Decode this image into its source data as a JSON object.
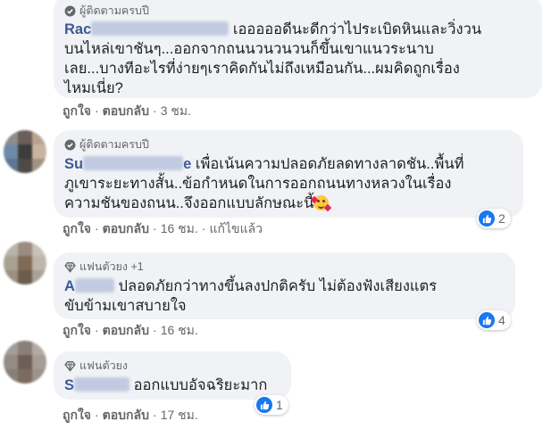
{
  "comments": [
    {
      "badge": "ผู้ติดตามครบปี",
      "badge_icon": "top-fan-badge-icon",
      "name_visible": "Rac",
      "name_tail": "",
      "text_after_name": "เอออออดีนะดีกว่าไประเบิดหินและวิ่งวน",
      "lines": [
        "บนไหล่เขาชันๆ...ออกจากถนนวนวนวนก็ขึ้นเขาแนวระนาบ",
        "เลย...บางทีอะไรที่ง่ายๆเราคิดกันไม่ถึงเหมือนกัน...ผมคิดถูกเรื่อง",
        "ไหมเนี่ย?"
      ],
      "like_label": "ถูกใจ",
      "reply_label": "ตอบกลับ",
      "time": "3 ชม.",
      "edited": "",
      "reaction_count": ""
    },
    {
      "badge": "ผู้ติดตามครบปี",
      "badge_icon": "top-fan-badge-icon",
      "name_visible": "Su",
      "name_tail": "e",
      "text_after_name": "เพื่อเน้นความปลอดภัยลดทางลาดชัน..พื้นที่",
      "lines": [
        "ภูเขาระยะทางสั้น..ข้อกำหนดในการออกถนนทางหลวงในเรื่อง",
        "ความชันของถนน..จึงออกแบบลักษณะนี้"
      ],
      "like_label": "ถูกใจ",
      "reply_label": "ตอบกลับ",
      "time": "16 ชม.",
      "edited": "แก้ไขแล้ว",
      "reaction_count": "2"
    },
    {
      "badge": "แฟนตัวยง +1",
      "badge_icon": "diamond-icon",
      "name_visible": "A",
      "name_tail": "",
      "text_after_name": "ปลอดภัยกว่าทางขึ้นลงปกติครับ ไม่ต้องฟังเสียงแตร",
      "lines": [
        "ขับข้ามเขาสบายใจ"
      ],
      "like_label": "ถูกใจ",
      "reply_label": "ตอบกลับ",
      "time": "16 ชม.",
      "edited": "",
      "reaction_count": "4"
    },
    {
      "badge": "แฟนตัวยง",
      "badge_icon": "diamond-icon",
      "name_visible": "S",
      "name_tail": "",
      "text_after_name": "ออกแบบอัจฉริยะมาก",
      "lines": [],
      "like_label": "ถูกใจ",
      "reply_label": "ตอบกลับ",
      "time": "17 ชม.",
      "edited": "",
      "reaction_count": "1"
    }
  ],
  "colors": {
    "bubble": "#f0f2f5",
    "name": "#3b5998",
    "meta": "#65676b",
    "like_blue": "#1877f2"
  }
}
